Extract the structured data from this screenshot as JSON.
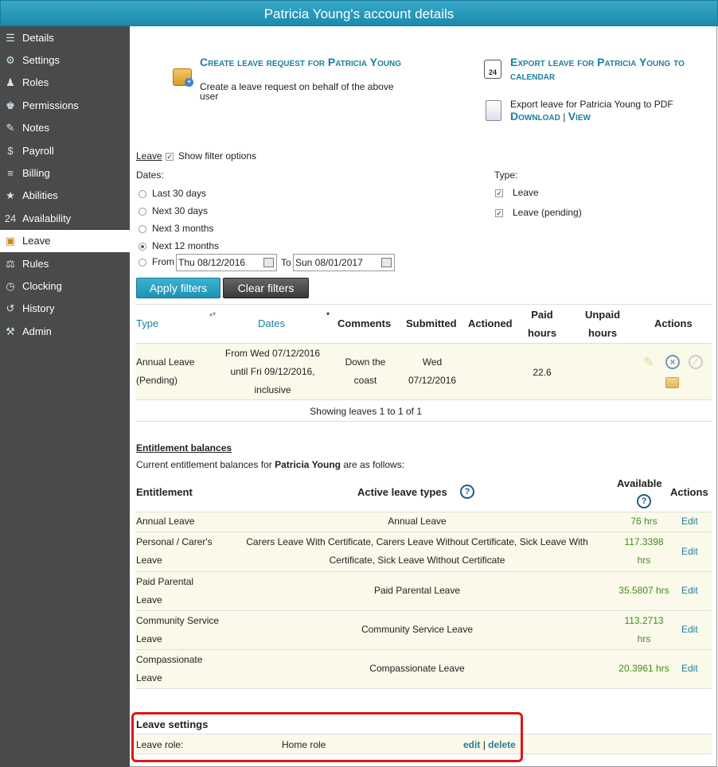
{
  "window": {
    "title": "Patricia Young's account details"
  },
  "sidebar": {
    "items": [
      {
        "label": "Details",
        "icon": "document-icon",
        "symbol": "☰"
      },
      {
        "label": "Settings",
        "icon": "gear-icon",
        "symbol": "⚙"
      },
      {
        "label": "Roles",
        "icon": "people-icon",
        "symbol": "♟"
      },
      {
        "label": "Permissions",
        "icon": "user-lock-icon",
        "symbol": "♚"
      },
      {
        "label": "Notes",
        "icon": "notepad-icon",
        "symbol": "✎"
      },
      {
        "label": "Payroll",
        "icon": "payroll-icon",
        "symbol": "$"
      },
      {
        "label": "Billing",
        "icon": "billing-icon",
        "symbol": "≡"
      },
      {
        "label": "Abilities",
        "icon": "badge-icon",
        "symbol": "★"
      },
      {
        "label": "Availability",
        "icon": "calendar-icon",
        "symbol": "24"
      },
      {
        "label": "Leave",
        "icon": "suitcase-icon",
        "symbol": "▣"
      },
      {
        "label": "Rules",
        "icon": "rules-icon",
        "symbol": "⚖"
      },
      {
        "label": "Clocking",
        "icon": "clock-icon",
        "symbol": "◷"
      },
      {
        "label": "History",
        "icon": "history-icon",
        "symbol": "↺"
      },
      {
        "label": "Admin",
        "icon": "wrench-icon",
        "symbol": "⚒"
      }
    ],
    "active": "Leave"
  },
  "actions": {
    "create_title": "Create leave request for Patricia Young",
    "create_desc": "Create a leave request on behalf of the above user",
    "export_cal_title": "Export leave for Patricia Young to calendar",
    "export_pdf_text": "Export leave for Patricia Young to PDF",
    "download": "Download",
    "sep": "|",
    "view": "View"
  },
  "filters": {
    "leave_link": "Leave",
    "show_filter_label": "Show filter options",
    "dates_label": "Dates:",
    "date_options": [
      "Last 30 days",
      "Next 30 days",
      "Next 3 months",
      "Next 12 months",
      "From"
    ],
    "selected": "Next 12 months",
    "from_value": "Thu 08/12/2016",
    "to_label": "To",
    "to_value": "Sun 08/01/2017",
    "type_label": "Type:",
    "type_options": [
      "Leave",
      "Leave (pending)"
    ],
    "apply": "Apply filters",
    "clear": "Clear filters"
  },
  "leave_table": {
    "headers": {
      "type": "Type",
      "dates": "Dates",
      "comments": "Comments",
      "submitted": "Submitted",
      "actioned": "Actioned",
      "paid1": "Paid",
      "paid2": "hours",
      "unpaid1": "Unpaid",
      "unpaid2": "hours",
      "actions": "Actions"
    },
    "row": {
      "type1": "Annual Leave",
      "type2": "(Pending)",
      "dates1": "From Wed 07/12/2016",
      "dates2": "until Fri 09/12/2016,",
      "dates3": "inclusive",
      "comments1": "Down the",
      "comments2": "coast",
      "sub1": "Wed",
      "sub2": "07/12/2016",
      "actioned": "",
      "paid": "22.6",
      "unpaid": ""
    },
    "footer_prefix": "Showing leaves ",
    "footer_from": "1",
    "footer_to_word": " to ",
    "footer_to": "1",
    "footer_of_word": " of ",
    "footer_total": "1"
  },
  "entitlements": {
    "heading": "Entitlement balances",
    "intro_prefix": "Current entitlement balances for ",
    "intro_name": "Patricia Young",
    "intro_suffix": " are as follows:",
    "headers": {
      "entitlement": "Entitlement",
      "types": "Active leave types",
      "available": "Available",
      "actions": "Actions"
    },
    "rows": [
      {
        "e1": "Annual Leave",
        "e2": "",
        "t1": "Annual Leave",
        "t2": "",
        "a1": "76 hrs",
        "a2": "",
        "edit": "Edit"
      },
      {
        "e1": "Personal / Carer's",
        "e2": "Leave",
        "t1": "Carers Leave With Certificate, Carers Leave Without Certificate, Sick Leave With",
        "t2": "Certificate, Sick Leave Without Certificate",
        "a1": "117.3398",
        "a2": "hrs",
        "edit": "Edit"
      },
      {
        "e1": "Paid Parental",
        "e2": "Leave",
        "t1": "Paid Parental Leave",
        "t2": "",
        "a1": "35.5807 hrs",
        "a2": "",
        "edit": "Edit"
      },
      {
        "e1": "Community Service",
        "e2": "Leave",
        "t1": "Community Service Leave",
        "t2": "",
        "a1": "113.2713",
        "a2": "hrs",
        "edit": "Edit"
      },
      {
        "e1": "Compassionate",
        "e2": "Leave",
        "t1": "Compassionate Leave",
        "t2": "",
        "a1": "20.3961 hrs",
        "a2": "",
        "edit": "Edit"
      }
    ]
  },
  "leave_settings": {
    "heading": "Leave settings",
    "label": "Leave role:",
    "value": "Home role",
    "edit": "edit",
    "sep": "|",
    "delete": "delete"
  },
  "colors": {
    "accent": "#1d7fa0",
    "sidebar": "#4a4a4a",
    "highlight_row": "#fbf9e9",
    "available_green": "#3a8f1a",
    "annotation_red": "#e01414"
  }
}
